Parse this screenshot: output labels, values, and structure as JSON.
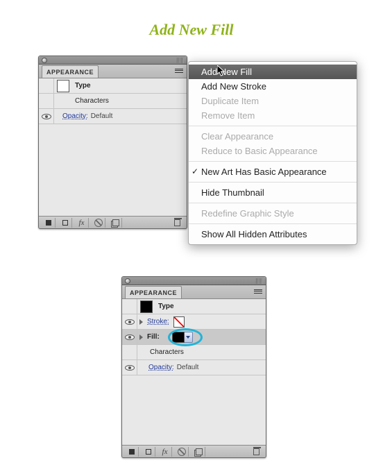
{
  "heading": "Add New Fill",
  "panel_top": {
    "tab_label": "APPEARANCE",
    "rows": {
      "type_label": "Type",
      "characters_label": "Characters",
      "opacity_label": "Opacity:",
      "opacity_value": "Default"
    }
  },
  "panel_bottom": {
    "tab_label": "APPEARANCE",
    "rows": {
      "type_label": "Type",
      "stroke_label": "Stroke:",
      "fill_label": "Fill:",
      "characters_label": "Characters",
      "opacity_label": "Opacity:",
      "opacity_value": "Default"
    }
  },
  "footer_icons": {
    "new_stroke": "new-stroke",
    "new_fill": "new-fill",
    "fx": "fx",
    "clear": "clear-appearance",
    "duplicate": "duplicate-item",
    "delete": "delete-item"
  },
  "menu": {
    "items": [
      {
        "label": "Add New Fill",
        "state": "highlight"
      },
      {
        "label": "Add New Stroke",
        "state": "normal"
      },
      {
        "label": "Duplicate Item",
        "state": "disabled"
      },
      {
        "label": "Remove Item",
        "state": "disabled"
      },
      {
        "sep": true
      },
      {
        "label": "Clear Appearance",
        "state": "disabled"
      },
      {
        "label": "Reduce to Basic Appearance",
        "state": "disabled"
      },
      {
        "sep": true
      },
      {
        "label": "New Art Has Basic Appearance",
        "state": "checked"
      },
      {
        "sep": true
      },
      {
        "label": "Hide Thumbnail",
        "state": "normal"
      },
      {
        "sep": true
      },
      {
        "label": "Redefine Graphic Style",
        "state": "disabled"
      },
      {
        "sep": true
      },
      {
        "label": "Show All Hidden Attributes",
        "state": "normal"
      }
    ]
  }
}
